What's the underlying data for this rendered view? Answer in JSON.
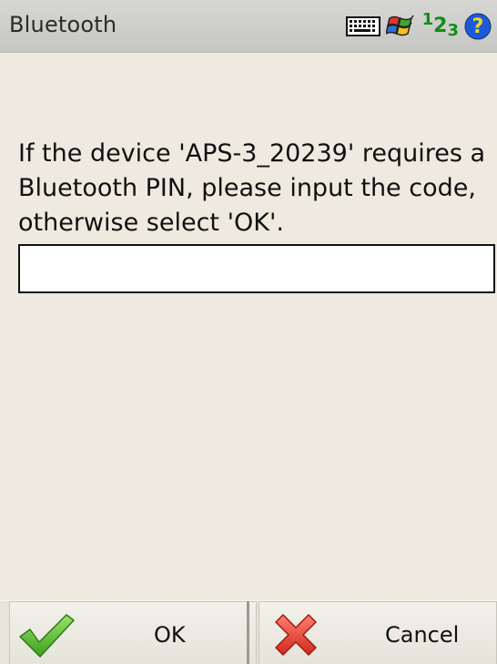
{
  "titlebar": {
    "title": "Bluetooth",
    "tray": {
      "keyboard_icon": "keyboard-icon",
      "windows_icon": "windows-flag-icon",
      "input_mode_label_1": "1",
      "input_mode_label_2": "2",
      "input_mode_label_3": "3",
      "help_icon": "help-icon"
    }
  },
  "dialog": {
    "message": "If the device 'APS-3_20239' requires a Bluetooth PIN, please input the code, otherwise select 'OK'.",
    "pin_value": "",
    "pin_placeholder": ""
  },
  "softkeys": {
    "ok_label": "OK",
    "ok_icon": "checkmark-icon",
    "cancel_label": "Cancel",
    "cancel_icon": "cross-icon"
  },
  "colors": {
    "background": "#EEEAE0",
    "titlebar": "#CFCFCB",
    "ok_icon": "#4DB82A",
    "cancel_icon": "#E0403A",
    "help_icon": "#1D5BD6",
    "input_mode": "#138D1B"
  }
}
